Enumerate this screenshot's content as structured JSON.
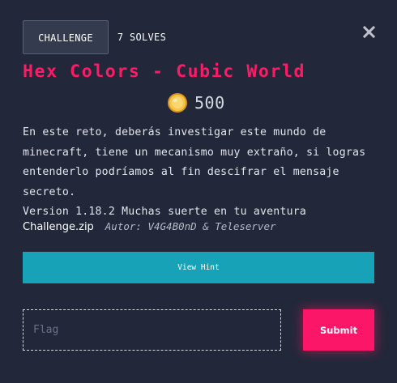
{
  "tabs": {
    "challenge": "CHALLENGE",
    "solves": "7 SOLVES"
  },
  "close_icon": "close-x-icon",
  "challenge": {
    "title": "Hex Colors - Cubic World",
    "points_icon": "gold-coin-icon",
    "points": "500",
    "description_lines": [
      "En este reto, deberás investigar este mundo de",
      "minecraft, tiene un mecanismo muy extraño, si logras",
      "entenderlo podríamos al fin descifrar el mensaje",
      "secreto.",
      "Version 1.18.2 Muchas suerte en tu aventura"
    ],
    "file_name": "Challenge.zip",
    "author": "Autor: V4G4B0nD & Teleserver"
  },
  "hint": {
    "label": "View Hint"
  },
  "flag": {
    "value": "",
    "placeholder": "Flag"
  },
  "submit": {
    "label": "Submit"
  },
  "colors": {
    "background": "#222839",
    "title": "#ff1a68",
    "hint_button": "#17a2b8",
    "submit_button": "#fb1668",
    "coin": "#f2b33d"
  }
}
